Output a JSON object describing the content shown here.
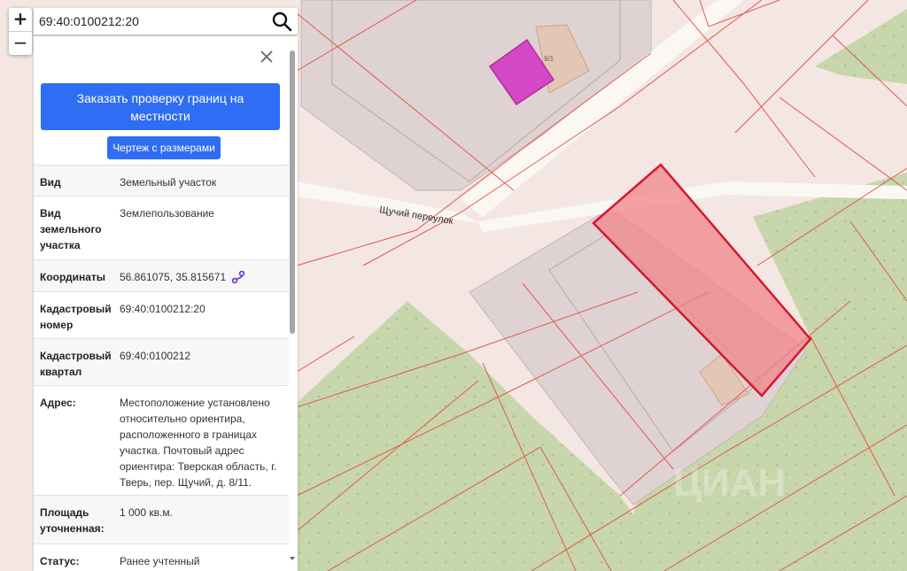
{
  "search": {
    "query": "69:40:0100212:20"
  },
  "zoom": {
    "in_label": "+",
    "out_label": "−"
  },
  "map": {
    "street_label": "Щучий переулок",
    "building_label": "9/1",
    "watermark": "ЦИАН",
    "colors": {
      "background": "#f3e6e3",
      "forest": "#c8d6ac",
      "road": "#fbf8f4",
      "parcel_border": "#e05a4f",
      "selected_parcel": "#d4182e",
      "highlight": "#d548c5"
    }
  },
  "panel": {
    "order_button": "Заказать проверку границ на местности",
    "drawing_button": "Чертеж с размерами",
    "rows": [
      {
        "label": "Вид",
        "value": "Земельный участок"
      },
      {
        "label": "Вид земельного участка",
        "value": "Землепользование"
      },
      {
        "label": "Координаты",
        "value": "56.861075, 35.815671"
      },
      {
        "label": "Кадастровый номер",
        "value": "69:40:0100212:20"
      },
      {
        "label": "Кадастровый квартал",
        "value": "69:40:0100212"
      },
      {
        "label": "Адрес:",
        "value": "Местоположение установлено относительно ориентира, расположенного в границах участка. Почтовый адрес ориентира: Тверская область, г. Тверь, пер. Щучий, д. 8/11."
      },
      {
        "label": "Площадь уточненная:",
        "value": "1 000 кв.м."
      },
      {
        "label": "Статус:",
        "value": "Ранее учтенный"
      }
    ]
  }
}
